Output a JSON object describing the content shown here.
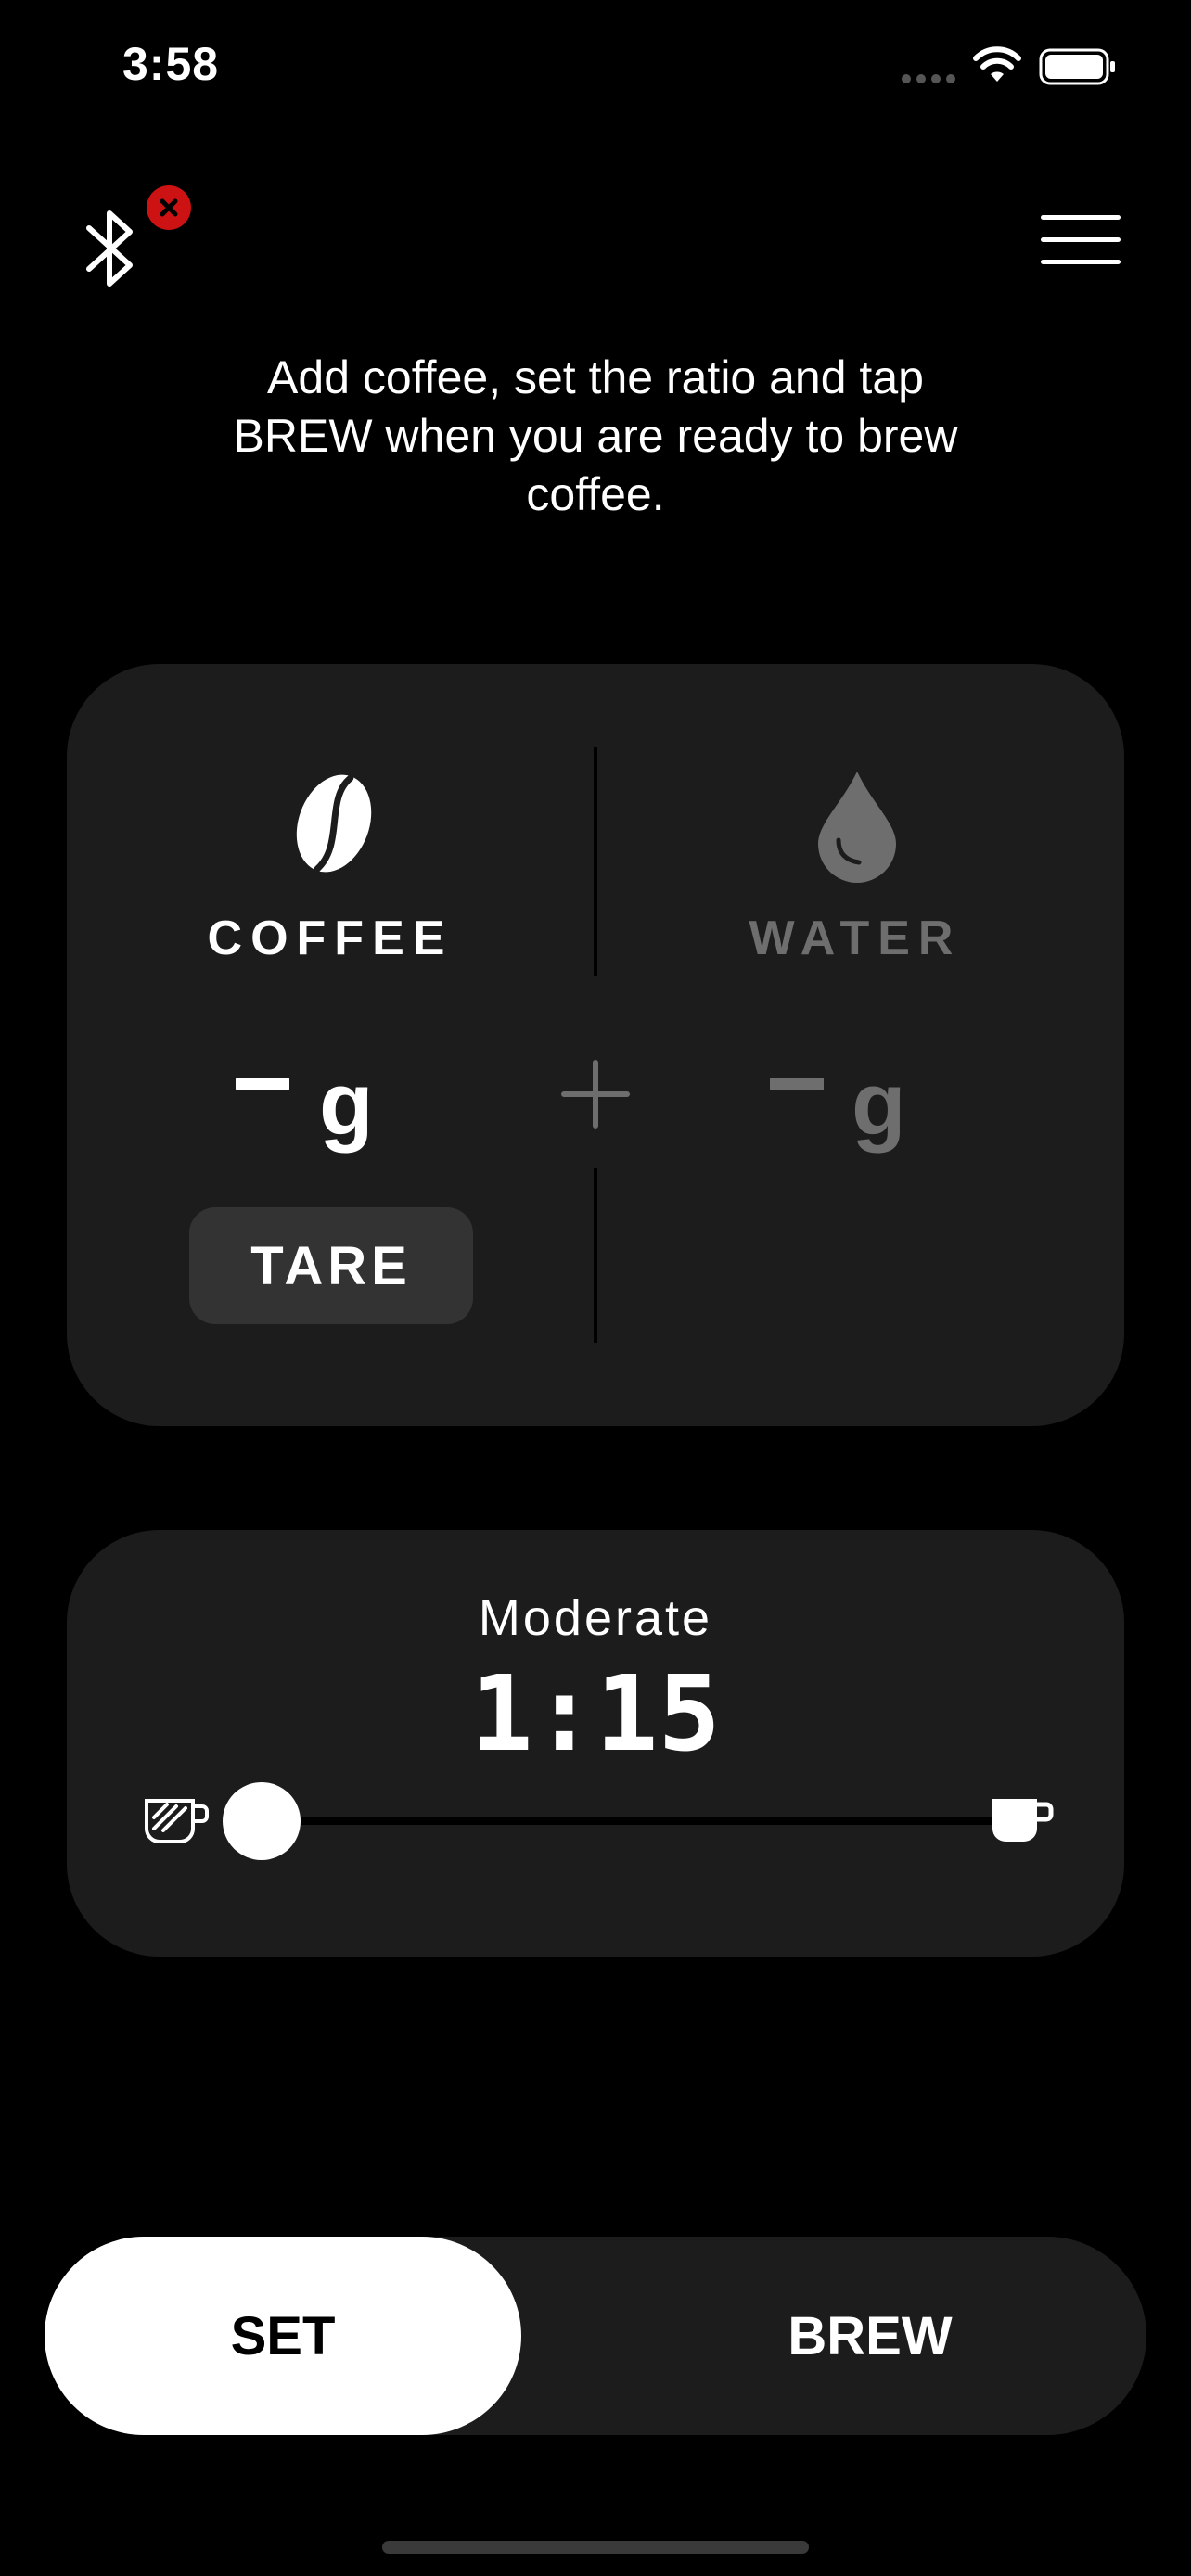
{
  "status_bar": {
    "time": "3:58"
  },
  "header": {
    "bluetooth_status": "disconnected"
  },
  "instruction": "Add coffee, set the ratio and tap BREW when you are ready to brew coffee.",
  "weights": {
    "coffee": {
      "label": "COFFEE",
      "unit": "g",
      "icon": "coffee-bean-icon"
    },
    "water": {
      "label": "WATER",
      "unit": "g",
      "icon": "water-drop-icon"
    },
    "tare_label": "TARE"
  },
  "ratio": {
    "name": "Moderate",
    "value": "1:15",
    "slider_level": 0.0,
    "left_icon": "strong-coffee-cup-icon",
    "right_icon": "mild-coffee-cup-icon"
  },
  "mode_switch": {
    "set_label": "SET",
    "brew_label": "BREW",
    "selected": "SET"
  },
  "colors": {
    "background": "#000000",
    "card": "#1c1c1d",
    "inactive_text": "#6e6e6e",
    "error": "#cc1212",
    "tare_button": "#333334"
  }
}
